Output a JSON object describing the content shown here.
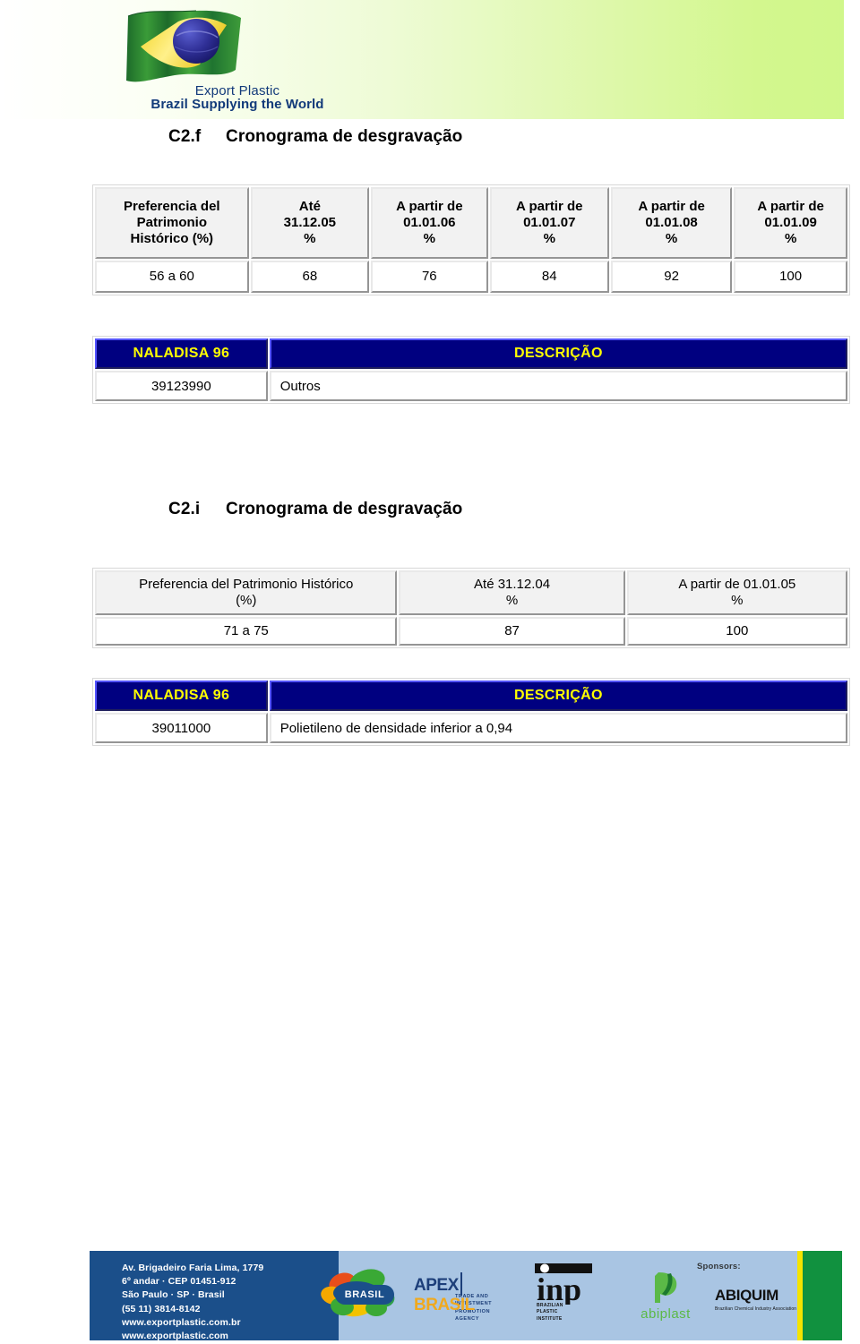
{
  "header": {
    "logo_line1": "Export Plastic",
    "logo_line2": "Brazil Supplying the World",
    "flag_alt": "brazil-flag-icon"
  },
  "sections": [
    {
      "id": "c2f",
      "number": "C2.f",
      "title": "Cronograma de desgravação",
      "schedule_table": {
        "headers": [
          "Preferencia del\nPatrimonio\nHistórico (%)",
          "Até\n31.12.05\n%",
          "A partir de\n01.01.06\n%",
          "A partir de\n01.01.07\n%",
          "A partir de\n01.01.08\n%",
          "A partir de\n01.01.09\n%"
        ],
        "header_lines": [
          [
            "Preferencia del",
            "Patrimonio",
            "Histórico (%)"
          ],
          [
            "Até",
            "31.12.05",
            "%"
          ],
          [
            "A partir de",
            "01.01.06",
            "%"
          ],
          [
            "A partir de",
            "01.01.07",
            "%"
          ],
          [
            "A partir de",
            "01.01.08",
            "%"
          ],
          [
            "A partir de",
            "01.01.09",
            "%"
          ]
        ],
        "row": [
          "56 a 60",
          "68",
          "76",
          "84",
          "92",
          "100"
        ]
      },
      "naladisa_table": {
        "headers": [
          "NALADISA 96",
          "DESCRIÇÃO"
        ],
        "rows": [
          {
            "code": "39123990",
            "description": "Outros"
          }
        ]
      }
    },
    {
      "id": "c2i",
      "number": "C2.i",
      "title": "Cronograma de desgravação",
      "schedule_table": {
        "header_lines": [
          [
            "Preferencia del Patrimonio Histórico",
            "(%)"
          ],
          [
            "Até 31.12.04",
            "%"
          ],
          [
            "A partir de 01.01.05",
            "%"
          ]
        ],
        "row": [
          "71 a 75",
          "87",
          "100"
        ]
      },
      "naladisa_table": {
        "headers": [
          "NALADISA 96",
          "DESCRIÇÃO"
        ],
        "rows": [
          {
            "code": "39011000",
            "description": "Polietileno de densidade inferior a 0,94"
          }
        ]
      }
    }
  ],
  "footer": {
    "address_lines": [
      "Av. Brigadeiro Faria Lima, 1779",
      "6º andar · CEP 01451-912",
      "São Paulo · SP · Brasil",
      "(55 11) 3814-8142",
      "www.exportplastic.com.br",
      "www.exportplastic.com"
    ],
    "sponsors_label": "Sponsors:",
    "logos": {
      "brasil": "BRASIL",
      "apex_1": "APEX",
      "apex_2": "BRASIL",
      "apex_sub": "TRADE AND INVESTMENT\nPROMOTION\nAGENCY",
      "apex_sub_lines": [
        "TRADE AND INVESTMENT",
        "PROMOTION",
        "AGENCY"
      ],
      "inp": "inp",
      "inp_sub_lines": [
        "BRAZILIAN",
        "PLASTIC",
        "INSTITUTE"
      ],
      "abiplast": "abiplast",
      "abiquim": "ABIQUIM",
      "abiquim_sub": "Brazilian Chemical Industry Association"
    }
  },
  "colors": {
    "naladisa_header_bg": "#000080",
    "naladisa_header_fg": "#ffff00",
    "header_gradient_end": "#d0f78a",
    "footer_address_bg": "#1b4f8a",
    "footer_sponsor_bg": "#a9c5e3",
    "footer_green": "#11913f",
    "footer_yellow": "#f4e400"
  }
}
